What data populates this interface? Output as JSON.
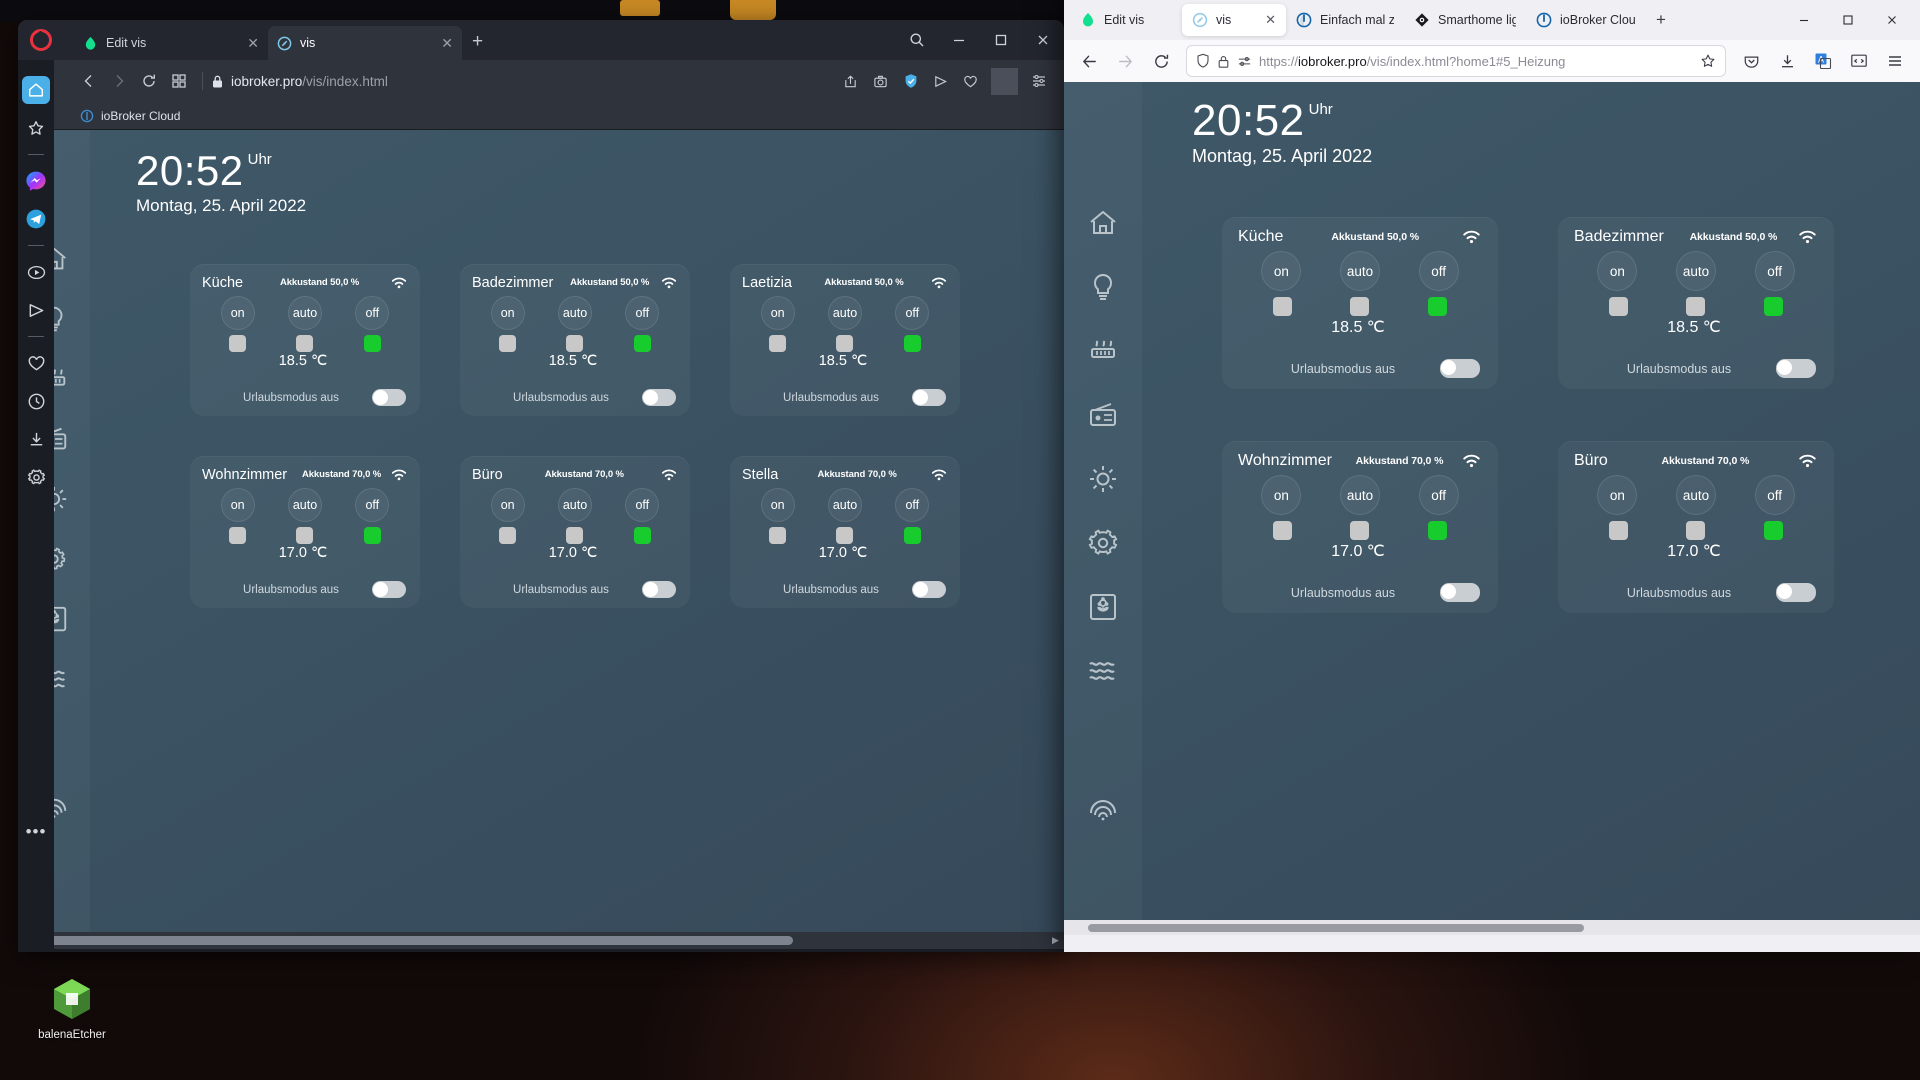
{
  "desktop": {
    "icon_label": "balenaEtcher",
    "icon_name": "balena-etcher-icon"
  },
  "opera": {
    "window_name": "Opera browser window",
    "tabs": [
      {
        "title": "Edit vis",
        "favicon": "ioBroker-vis-edit-icon",
        "active": false,
        "close": "✕"
      },
      {
        "title": "vis",
        "favicon": "ioBroker-vis-icon",
        "active": true,
        "close": "✕"
      }
    ],
    "new_tab_label": "+",
    "window_controls": {
      "search": "🔍",
      "minimize": "–",
      "maximize": "□",
      "close": "✕"
    },
    "url": {
      "host": "iobroker.pro",
      "path": "/vis/index.html",
      "lock": "lock-icon"
    },
    "toolbar_icons": [
      "back-icon",
      "forward-icon",
      "reload-icon",
      "tab-grid-icon"
    ],
    "right_icons": [
      "share-icon",
      "snapshot-icon",
      "shield-icon",
      "send-icon",
      "heart-icon",
      "menu-icon"
    ],
    "bookmark": {
      "label": "ioBroker Cloud",
      "favicon": "iobroker-cloud-icon"
    },
    "sidebar": [
      {
        "name": "sidebar-home",
        "icon": "home-icon",
        "selected": true
      },
      {
        "name": "sidebar-favorites",
        "icon": "star-icon",
        "selected": false
      },
      {
        "name": "sidebar-divider-1",
        "icon": "divider",
        "selected": false
      },
      {
        "name": "sidebar-messenger",
        "icon": "messenger-icon",
        "selected": false
      },
      {
        "name": "sidebar-telegram",
        "icon": "telegram-icon",
        "selected": false
      },
      {
        "name": "sidebar-divider-2",
        "icon": "divider",
        "selected": false
      },
      {
        "name": "sidebar-player",
        "icon": "player-icon",
        "selected": false
      },
      {
        "name": "sidebar-flow",
        "icon": "flow-send-icon",
        "selected": false
      },
      {
        "name": "sidebar-divider-3",
        "icon": "divider",
        "selected": false
      },
      {
        "name": "sidebar-pinboards",
        "icon": "heart-icon",
        "selected": false
      },
      {
        "name": "sidebar-history",
        "icon": "clock-icon",
        "selected": false
      },
      {
        "name": "sidebar-downloads",
        "icon": "download-icon",
        "selected": false
      },
      {
        "name": "sidebar-settings",
        "icon": "gear-icon",
        "selected": false
      }
    ],
    "sidebar_more": "•••",
    "scrollbar": {
      "left_arrow": "◀",
      "right_arrow": "▶"
    }
  },
  "firefox": {
    "window_name": "Firefox browser window",
    "tabs": [
      {
        "title": "Edit vis",
        "favicon": "ioBroker-vis-edit-icon",
        "active": false
      },
      {
        "title": "vis",
        "favicon": "ioBroker-vis-icon",
        "active": true,
        "close": "✕"
      },
      {
        "title": "Einfach mal ze",
        "favicon": "power-circle-icon",
        "active": false
      },
      {
        "title": "Smarthome lig",
        "favicon": "smarthome-icon",
        "active": false
      },
      {
        "title": "ioBroker Clou",
        "favicon": "iobroker-cloud-icon",
        "active": false
      }
    ],
    "new_tab_label": "+",
    "window_controls": {
      "minimize": "–",
      "maximize": "□",
      "close": "✕"
    },
    "url": {
      "scheme": "https://",
      "host": "iobroker.pro",
      "path": "/vis/index.html?home1#5_Heizung",
      "shield": "shield-icon",
      "lock": "lock-icon",
      "perms": "permissions-icon",
      "star": "bookmark-star-icon"
    },
    "nav_icons": [
      "back-icon",
      "forward-icon",
      "reload-icon"
    ],
    "right_icons": [
      "pocket-icon",
      "downloads-icon",
      "translate-icon",
      "devtools-icon",
      "hamburger-menu-icon"
    ]
  },
  "vis": {
    "clock": {
      "time": "20:52",
      "unit": "Uhr",
      "date": "Montag, 25. April 2022"
    },
    "nav_items": [
      {
        "name": "vis-nav-home",
        "icon": "home-icon"
      },
      {
        "name": "vis-nav-light",
        "icon": "lightbulb-icon"
      },
      {
        "name": "vis-nav-heating",
        "icon": "radiator-icon"
      },
      {
        "name": "vis-nav-radio",
        "icon": "radio-icon"
      },
      {
        "name": "vis-nav-brightness",
        "icon": "sun-icon"
      },
      {
        "name": "vis-nav-settings",
        "icon": "gear-icon"
      },
      {
        "name": "vis-nav-garden",
        "icon": "flower-box-icon"
      },
      {
        "name": "vis-nav-water",
        "icon": "waves-icon"
      },
      {
        "name": "vis-nav-sensor",
        "icon": "fingerprint-icon"
      }
    ],
    "buttons": {
      "on": "on",
      "auto": "auto",
      "off": "off"
    },
    "cards": [
      {
        "title": "Küche",
        "battery": "Akkustand 50,0 %",
        "wifi": "wifi-icon",
        "leds": [
          "off",
          "off",
          "on"
        ],
        "temperature": "18.5 ℃",
        "vacation_label": "Urlaubsmodus aus",
        "vacation_on": false
      },
      {
        "title": "Badezimmer",
        "battery": "Akkustand 50,0 %",
        "wifi": "wifi-icon",
        "leds": [
          "off",
          "off",
          "on"
        ],
        "temperature": "18.5 ℃",
        "vacation_label": "Urlaubsmodus aus",
        "vacation_on": false
      },
      {
        "title": "Laetizia",
        "battery": "Akkustand 50,0 %",
        "wifi": "wifi-icon",
        "leds": [
          "off",
          "off",
          "on"
        ],
        "temperature": "18.5 ℃",
        "vacation_label": "Urlaubsmodus aus",
        "vacation_on": false
      },
      {
        "title": "Wohnzimmer",
        "battery": "Akkustand 70,0 %",
        "wifi": "wifi-icon",
        "leds": [
          "off",
          "off",
          "on"
        ],
        "temperature": "17.0 ℃",
        "vacation_label": "Urlaubsmodus aus",
        "vacation_on": false
      },
      {
        "title": "Büro",
        "battery": "Akkustand 70,0 %",
        "wifi": "wifi-icon",
        "leds": [
          "off",
          "off",
          "on"
        ],
        "temperature": "17.0 ℃",
        "vacation_label": "Urlaubsmodus aus",
        "vacation_on": false
      },
      {
        "title": "Stella",
        "battery": "Akkustand 70,0 %",
        "wifi": "wifi-icon",
        "leds": [
          "off",
          "off",
          "on"
        ],
        "temperature": "17.0 ℃",
        "vacation_label": "Urlaubsmodus aus",
        "vacation_on": false
      }
    ],
    "firefox_cards": [
      {
        "title": "Küche",
        "battery": "Akkustand 50,0 %",
        "temperature": "18.5 ℃",
        "vacation_label": "Urlaubsmodus aus"
      },
      {
        "title": "Badezimmer",
        "battery": "Akkustand 50,0 %",
        "temperature": "18.5 ℃",
        "vacation_label": "Urlaubsmodus aus"
      },
      {
        "title": "Wohnzimmer",
        "battery": "Akkustand 70,0 %",
        "temperature": "17.0 ℃",
        "vacation_label": "Urlaubsmodus aus"
      },
      {
        "title": "Büro",
        "battery": "Akkustand 70,0 %",
        "temperature": "17.0 ℃",
        "vacation_label": "Urlaubsmodus aus"
      }
    ]
  },
  "colors": {
    "led_on": "#17cc2c",
    "led_off": "#c8c8c8",
    "vis_bg": "#3d5465",
    "opera_red": "#e8333f",
    "opera_chrome": "#2f333c",
    "firefox_chrome": "#f0f0f4"
  }
}
